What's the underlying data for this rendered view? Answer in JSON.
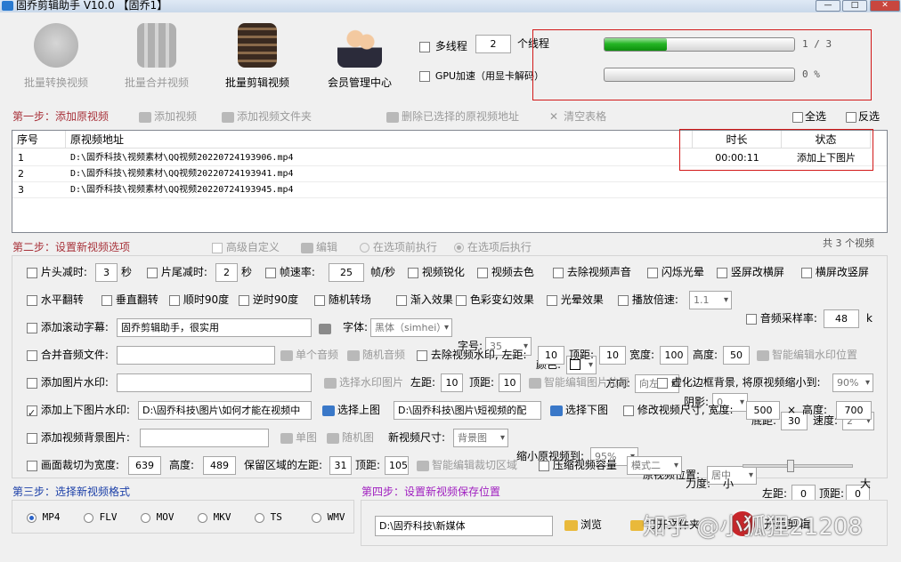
{
  "window": {
    "title": "固乔剪辑助手 V10.0  【固乔1】"
  },
  "toolbar": {
    "batch_convert": "批量转换视频",
    "batch_merge": "批量合并视频",
    "batch_edit": "批量剪辑视频",
    "member_center": "会员管理中心"
  },
  "threads": {
    "multithread_label": "多线程",
    "count": "2",
    "count_unit": "个线程",
    "gpu_label": "GPU加速（用显卡解码）",
    "progress1_text": "1 / 3",
    "progress1_fraction": 0.33,
    "progress2_text": "0 %",
    "progress2_fraction": 0
  },
  "step1": {
    "title": "第一步：添加原视频",
    "add_video": "添加视频",
    "add_folder": "添加视频文件夹",
    "delete_selected": "删除已选择的原视频地址",
    "clear_table": "清空表格",
    "select_all": "全选",
    "invert": "反选"
  },
  "table": {
    "headers": {
      "index": "序号",
      "path": "原视频地址",
      "duration": "时长",
      "status": "状态"
    },
    "rows": [
      {
        "index": "1",
        "path": "D:\\固乔科技\\视频素材\\QQ视频20220724193906.mp4",
        "duration": "00:00:11",
        "status": "添加上下图片"
      },
      {
        "index": "2",
        "path": "D:\\固乔科技\\视频素材\\QQ视频20220724193941.mp4",
        "duration": "",
        "status": ""
      },
      {
        "index": "3",
        "path": "D:\\固乔科技\\视频素材\\QQ视频20220724193945.mp4",
        "duration": "",
        "status": ""
      }
    ]
  },
  "step2": {
    "title": "第二步：设置新视频选项",
    "advanced": "高级自定义",
    "edit": "编辑",
    "before": "在选项前执行",
    "after": "在选项后执行",
    "count_text": "共 3 个视频"
  },
  "row1": {
    "head_cut": "片头减时:",
    "head_val": "3",
    "sec": "秒",
    "tail_cut": "片尾减时:",
    "tail_val": "2",
    "sec2": "秒",
    "fps": "帧速率:",
    "fps_val": "25",
    "fps_unit": "帧/秒",
    "sharpen": "视频锐化",
    "decolor": "视频去色",
    "remove_audio": "去除视频声音",
    "flash": "闪烁光晕",
    "v2h": "竖屏改横屏",
    "h2v": "横屏改竖屏"
  },
  "row2": {
    "hflip": "水平翻转",
    "vflip": "垂直翻转",
    "cw90": "顺时90度",
    "ccw90": "逆时90度",
    "random_transition": "随机转场",
    "fade_in": "渐入效果",
    "color_shift": "色彩变幻效果",
    "halo": "光晕效果",
    "speed": "播放倍速:",
    "speed_val": "1.1",
    "sample_rate": "音频采样率:",
    "sample_val": "48",
    "k": "k"
  },
  "row3": {
    "scroll_sub": "添加滚动字幕:",
    "sub_text": "固乔剪辑助手，很实用",
    "font": "字体:",
    "font_val": "黑体（simhei）",
    "size": "字号:",
    "size_val": "35",
    "color": "颜色:",
    "direction": "方向:",
    "direction_val": "向左",
    "shadow": "阴影:",
    "shadow_val": "0",
    "bottom": "底距:",
    "bottom_val": "30",
    "speed": "速度:",
    "speed_val": "2"
  },
  "row4": {
    "merge_audio": "合并音频文件:",
    "single_audio": "单个音频",
    "random_audio": "随机音频",
    "remove_wm": "去除视频水印, 左距:",
    "left": "10",
    "top_label": "顶距:",
    "top": "10",
    "width_label": "宽度:",
    "width": "100",
    "height_label": "高度:",
    "height": "50",
    "smart_wm": "智能编辑水印位置"
  },
  "row5": {
    "img_wm": "添加图片水印:",
    "choose_wm": "选择水印图片",
    "left_label": "左距:",
    "left": "10",
    "top_label": "顶距:",
    "top": "10",
    "smart_img": "智能编辑图片位置",
    "blur_bg": "虚化边框背景, 将原视频缩小到:",
    "scale_val": "90%"
  },
  "row6": {
    "updown": "添加上下图片水印:",
    "top_path": "D:\\固乔科技\\图片\\如何才能在视频中",
    "choose_top": "选择上图",
    "bottom_path": "D:\\固乔科技\\图片\\短视频的配",
    "choose_bottom": "选择下图",
    "resize": "修改视频尺寸, 宽度:",
    "width": "500",
    "x": "×",
    "height_label": "高度:",
    "height": "700"
  },
  "row7": {
    "bg_img": "添加视频背景图片:",
    "single_img": "单图",
    "random_img": "随机图",
    "new_size": "新视频尺寸:",
    "new_size_val": "背景图",
    "shrink": "缩小原视频到:",
    "shrink_val": "95%",
    "position": "原视频位置:",
    "position_val": "居中",
    "left_label": "左距:",
    "left": "0",
    "top_label": "顶距:",
    "top": "0"
  },
  "row8": {
    "crop": "画面裁切为宽度:",
    "crop_w": "639",
    "height_label": "高度:",
    "crop_h": "489",
    "keep_left": "保留区域的左距:",
    "left": "31",
    "top_label": "顶距:",
    "top": "105",
    "smart_crop": "智能编辑裁切区域",
    "compress": "压缩视频容量",
    "mode_val": "模式二",
    "strength": "力度:",
    "small": "小",
    "big": "大",
    "strength_fraction": 0.42
  },
  "step3": {
    "title": "第三步：选择新视频格式",
    "formats": [
      "MP4",
      "FLV",
      "MOV",
      "MKV",
      "TS",
      "WMV"
    ],
    "selected": "MP4"
  },
  "step4": {
    "title": "第四步：设置新视频保存位置",
    "path": "D:\\固乔科技\\新媒体",
    "browse": "浏览",
    "open_folder": "打开文件夹",
    "start": "开始剪辑"
  },
  "watermark": {
    "text": "知乎 @小狐狸21208"
  },
  "colors": {
    "step_red": "#a8323a",
    "step_blue": "#1b3fa8",
    "step_purple": "#a020c0",
    "highlight": "#d21818",
    "progress_green": "#24b524"
  }
}
